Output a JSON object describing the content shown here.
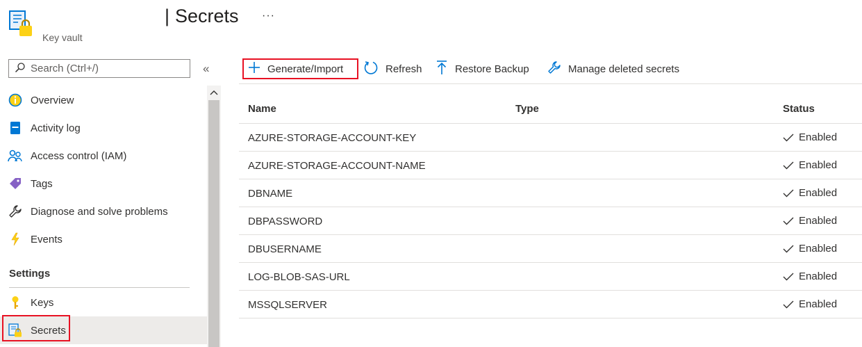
{
  "header": {
    "title": "Secrets",
    "separator": "|",
    "resource_type": "Key vault",
    "more": "···"
  },
  "sidebar": {
    "search_placeholder": "Search (Ctrl+/)",
    "collapse": "«",
    "items": [
      {
        "label": "Overview",
        "icon": "overview-icon"
      },
      {
        "label": "Activity log",
        "icon": "activity-log-icon"
      },
      {
        "label": "Access control (IAM)",
        "icon": "access-control-icon"
      },
      {
        "label": "Tags",
        "icon": "tag-icon"
      },
      {
        "label": "Diagnose and solve problems",
        "icon": "wrench-icon"
      },
      {
        "label": "Events",
        "icon": "lightning-icon"
      }
    ],
    "settings_header": "Settings",
    "settings_items": [
      {
        "label": "Keys",
        "icon": "key-icon"
      },
      {
        "label": "Secrets",
        "icon": "secrets-icon",
        "selected": true
      }
    ]
  },
  "toolbar": {
    "generate_label": "Generate/Import",
    "refresh_label": "Refresh",
    "restore_label": "Restore Backup",
    "manage_label": "Manage deleted secrets"
  },
  "table": {
    "columns": [
      "Name",
      "Type",
      "Status"
    ],
    "rows": [
      {
        "name": "AZURE-STORAGE-ACCOUNT-KEY",
        "type": "",
        "status": "Enabled"
      },
      {
        "name": "AZURE-STORAGE-ACCOUNT-NAME",
        "type": "",
        "status": "Enabled"
      },
      {
        "name": "DBNAME",
        "type": "",
        "status": "Enabled"
      },
      {
        "name": "DBPASSWORD",
        "type": "",
        "status": "Enabled"
      },
      {
        "name": "DBUSERNAME",
        "type": "",
        "status": "Enabled"
      },
      {
        "name": "LOG-BLOB-SAS-URL",
        "type": "",
        "status": "Enabled"
      },
      {
        "name": "MSSQLSERVER",
        "type": "",
        "status": "Enabled"
      }
    ]
  },
  "colors": {
    "accent": "#0078d4",
    "highlight": "#e81123",
    "selected_bg": "#edebe9"
  }
}
